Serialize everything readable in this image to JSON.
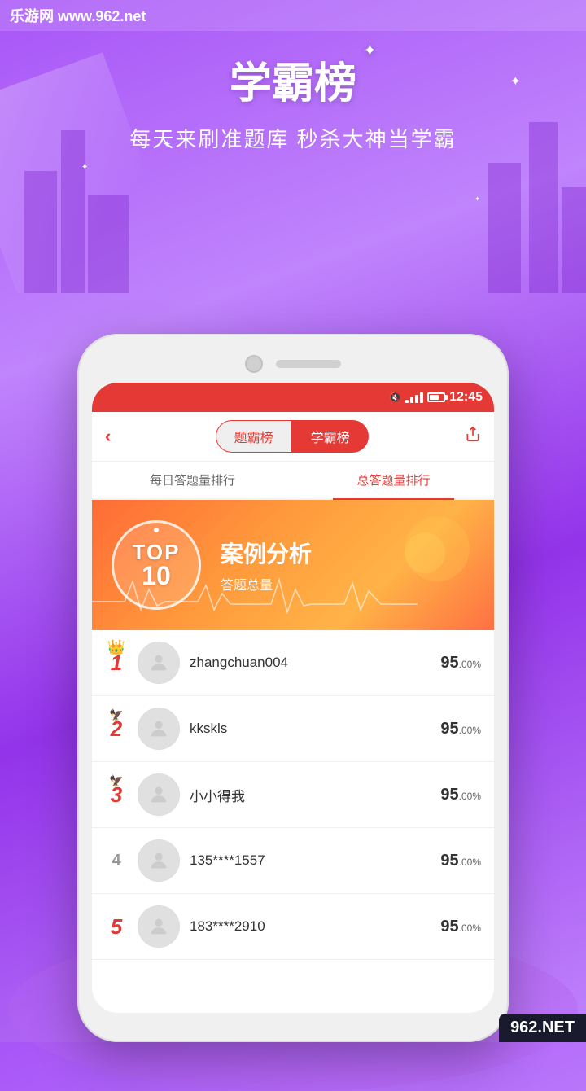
{
  "watermark": {
    "top_left": "乐游网 www.962.net",
    "bottom_right": "962.NET"
  },
  "background": {
    "title": "学霸榜",
    "subtitle": "每天来刷准题库 秒杀大神当学霸"
  },
  "statusBar": {
    "time": "12:45"
  },
  "navBar": {
    "back_label": "‹",
    "tab1": "题霸榜",
    "tab2": "学霸榜",
    "share_icon": "share"
  },
  "subTabs": {
    "tab1": "每日答题量排行",
    "tab2": "总答题量排行"
  },
  "banner": {
    "top_text": "TOP",
    "num_text": "10",
    "title": "案例分析",
    "subtitle": "答题总量"
  },
  "leaderboard": [
    {
      "rank": "1",
      "name": "zhangchuan004",
      "score_big": "95",
      "score_small": ".00",
      "score_pct": "%",
      "decoration": "crown"
    },
    {
      "rank": "2",
      "name": "kkskls",
      "score_big": "95",
      "score_small": ".00",
      "score_pct": "%",
      "decoration": "wing"
    },
    {
      "rank": "3",
      "name": "小小得我",
      "score_big": "95",
      "score_small": ".00",
      "score_pct": "%",
      "decoration": "wing"
    },
    {
      "rank": "4",
      "name": "135****1557",
      "score_big": "95",
      "score_small": ".00",
      "score_pct": "%",
      "decoration": "none"
    },
    {
      "rank": "5",
      "name": "183****2910",
      "score_big": "95",
      "score_small": ".00",
      "score_pct": "%",
      "decoration": "none"
    }
  ]
}
